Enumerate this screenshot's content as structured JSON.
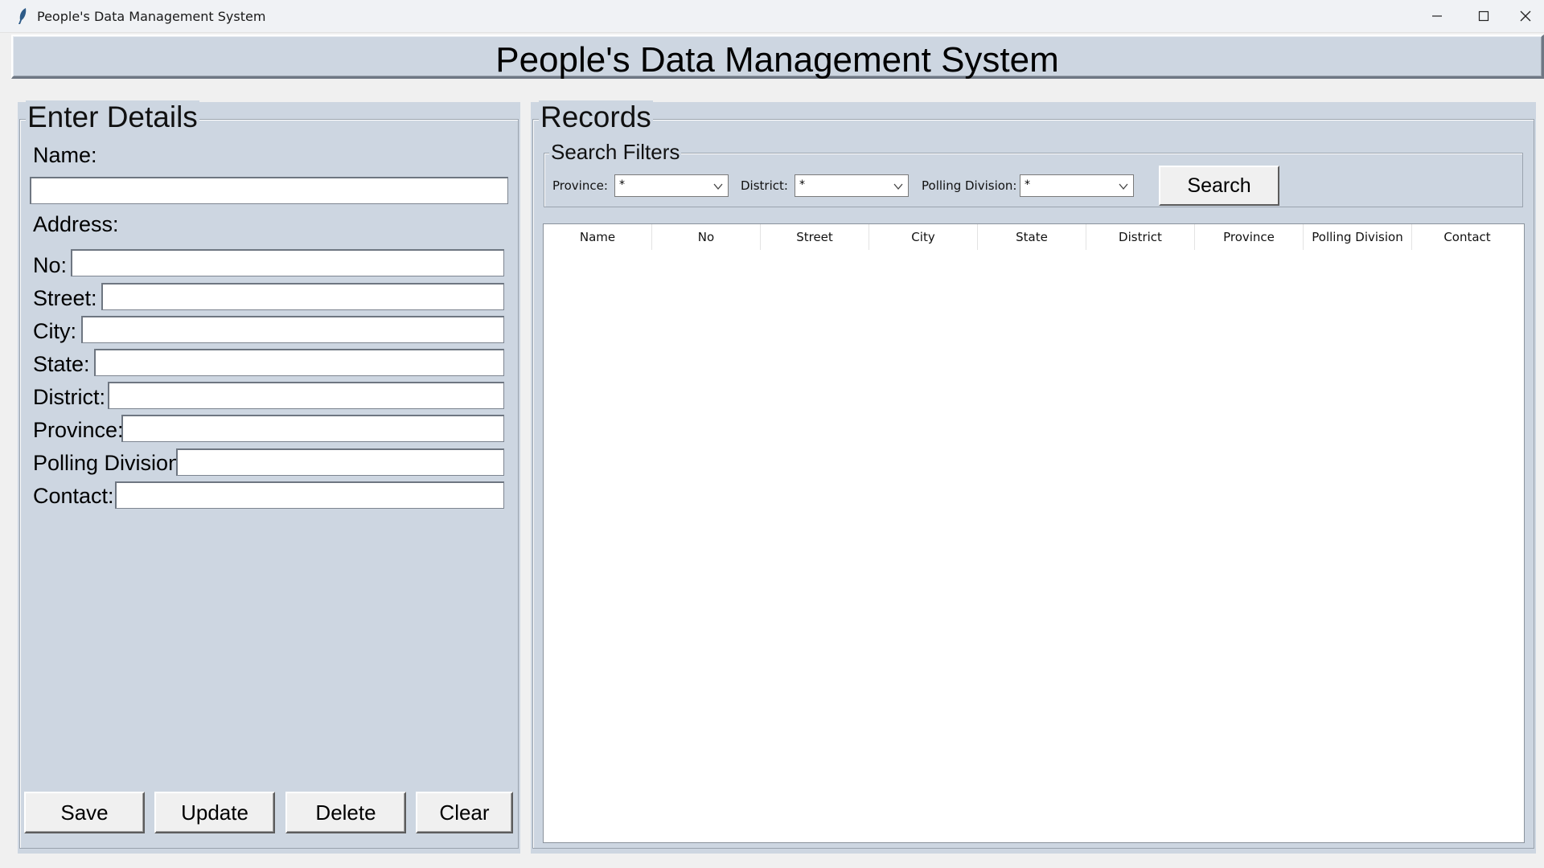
{
  "window": {
    "title": "People's Data Management System",
    "controls": [
      "minimize-icon",
      "maximize-icon",
      "close-icon"
    ]
  },
  "header": {
    "title": "People's Data Management System"
  },
  "form": {
    "group_title": "Enter Details",
    "name_label": "Name:",
    "address_label": "Address:",
    "fields": {
      "no": "No:",
      "street": "Street:",
      "city": "City:",
      "state": "State:",
      "district": "District:",
      "province": "Province:",
      "polling_division": "Polling Division:",
      "contact": "Contact:"
    },
    "values": {
      "name": "",
      "no": "",
      "street": "",
      "city": "",
      "state": "",
      "district": "",
      "province": "",
      "polling_division": "",
      "contact": ""
    },
    "buttons": {
      "save": "Save",
      "update": "Update",
      "delete": "Delete",
      "clear": "Clear"
    }
  },
  "records": {
    "group_title": "Records",
    "filters": {
      "group_title": "Search Filters",
      "province_label": "Province:",
      "province_value": "*",
      "district_label": "District:",
      "district_value": "*",
      "polling_label": "Polling Division:",
      "polling_value": "*",
      "search_button": "Search"
    },
    "table": {
      "columns": [
        "Name",
        "No",
        "Street",
        "City",
        "State",
        "District",
        "Province",
        "Polling Division",
        "Contact"
      ],
      "rows": []
    }
  },
  "colors": {
    "panel": "#cdd6e1",
    "window": "#f0f0f0"
  }
}
